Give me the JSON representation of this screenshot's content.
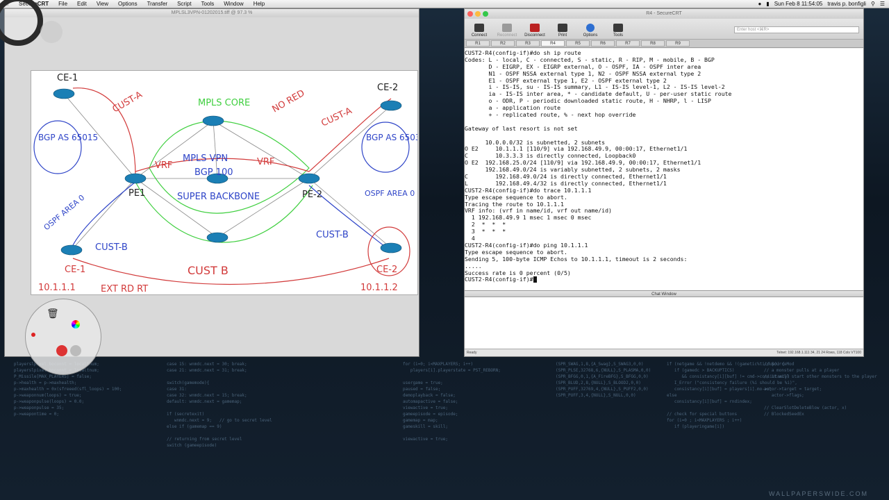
{
  "menubar": {
    "app_name": "SecureCRT",
    "items": [
      "File",
      "Edit",
      "View",
      "Options",
      "Transfer",
      "Script",
      "Tools",
      "Window",
      "Help"
    ],
    "clock": "Sun Feb 8  11:54:05",
    "user": "travis p. bonfigli"
  },
  "viewer": {
    "title": "MPLSL3VPN-01202015.tiff @ 97.3 %"
  },
  "whiteboard": {
    "labels": {
      "ce1": "CE-1",
      "ce2": "CE-2",
      "cust_a_left": "CUST-A",
      "cust_a_right": "CUST-A",
      "mpls_core": "MPLS CORE",
      "no_red": "NO RED",
      "bgp_left": "BGP AS 65015",
      "bgp_right": "BGP AS 65039",
      "vrf_left": "VRF",
      "vrf_right": "VRF",
      "mpls_vpn": "MPLS VPN",
      "bgp_100": "BGP 100",
      "super_backbone": "SUPER BACKBONE",
      "pe1": "PE1",
      "pe2": "PE-2",
      "ospf_left": "OSPF AREA 0",
      "ospf_right": "OSPF AREA 0",
      "cust_b_left": "CUST-B",
      "cust_b_right": "CUST-B",
      "cust_b_bottom": "CUST B",
      "ce_bottom_left": "CE-1",
      "ce_bottom_right": "CE-2",
      "ip_left": "10.1.1.1",
      "ip_right": "10.1.1.2",
      "ext_rd_rt": "EXT  RD  RT"
    }
  },
  "securecrt": {
    "title": "R4 - SecureCRT",
    "toolbar": [
      {
        "label": "Connect",
        "enabled": true
      },
      {
        "label": "Reconnect",
        "enabled": false
      },
      {
        "label": "Disconnect",
        "enabled": true
      },
      {
        "label": "Print",
        "enabled": true
      },
      {
        "label": "Options",
        "enabled": true
      },
      {
        "label": "Tools",
        "enabled": true
      }
    ],
    "host_placeholder": "Enter host <⌘R>",
    "tabs": [
      "R1",
      "R2",
      "R3",
      "R4",
      "R5",
      "R6",
      "R7",
      "R8",
      "R9"
    ],
    "active_tab": "R4",
    "terminal_lines": [
      "CUST2-R4(config-if)#do sh ip route",
      "Codes: L - local, C - connected, S - static, R - RIP, M - mobile, B - BGP",
      "       D - EIGRP, EX - EIGRP external, O - OSPF, IA - OSPF inter area",
      "       N1 - OSPF NSSA external type 1, N2 - OSPF NSSA external type 2",
      "       E1 - OSPF external type 1, E2 - OSPF external type 2",
      "       i - IS-IS, su - IS-IS summary, L1 - IS-IS level-1, L2 - IS-IS level-2",
      "       ia - IS-IS inter area, * - candidate default, U - per-user static route",
      "       o - ODR, P - periodic downloaded static route, H - NHRP, l - LISP",
      "       a - application route",
      "       + - replicated route, % - next hop override",
      "",
      "Gateway of last resort is not set",
      "",
      "      10.0.0.0/32 is subnetted, 2 subnets",
      "O E2     10.1.1.1 [110/9] via 192.168.49.9, 00:00:17, Ethernet1/1",
      "C        10.3.3.3 is directly connected, Loopback0",
      "O E2  192.168.25.0/24 [110/9] via 192.168.49.9, 00:00:17, Ethernet1/1",
      "      192.168.49.0/24 is variably subnetted, 2 subnets, 2 masks",
      "C        192.168.49.0/24 is directly connected, Ethernet1/1",
      "L        192.168.49.4/32 is directly connected, Ethernet1/1",
      "CUST2-R4(config-if)#do trace 10.1.1.1",
      "Type escape sequence to abort.",
      "Tracing the route to 10.1.1.1",
      "VRF info: (vrf in name/id, vrf out name/id)",
      "  1 192.168.49.9 1 msec 1 msec 0 msec",
      "  2  *  *  *",
      "  3  *  *  *",
      "  4",
      "CUST2-R4(config-if)#do ping 10.1.1.1",
      "Type escape sequence to abort.",
      "Sending 5, 100-byte ICMP Echos to 10.1.1.1, timeout is 2 seconds:",
      ".....",
      "Success rate is 0 percent (0/5)",
      "CUST2-R4(config-if)#"
    ],
    "chat_title": "Chat Window",
    "status_left": "Ready",
    "status_right": "Telnet: 192.168.1.111   34, 21   24 Rows, 118 Cols   VT100"
  },
  "watermark": "WALLPAPERSWIDE.COM"
}
